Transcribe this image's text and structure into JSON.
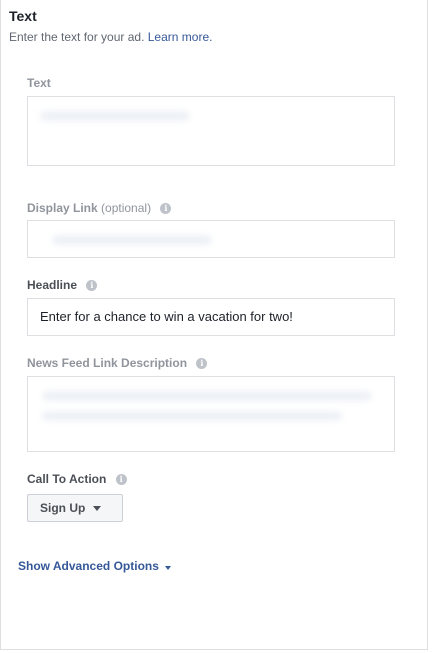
{
  "section": {
    "title": "Text",
    "subtitle": "Enter the text for your ad.",
    "learn_more": "Learn more."
  },
  "fields": {
    "text": {
      "label": "Text",
      "value": ""
    },
    "display_link": {
      "label": "Display Link",
      "optional": "(optional)",
      "value": ""
    },
    "headline": {
      "label": "Headline",
      "value": "Enter for a chance to win a vacation for two!"
    },
    "news_feed_description": {
      "label": "News Feed Link Description",
      "value": ""
    }
  },
  "call_to_action": {
    "label": "Call To Action",
    "selected": "Sign Up"
  },
  "advanced_options": {
    "label": "Show Advanced Options"
  },
  "icons": {
    "info": "info-icon",
    "dropdown": "caret-down-icon"
  },
  "colors": {
    "link": "#365899",
    "label_muted": "#90949c",
    "border": "#dddfe2"
  }
}
